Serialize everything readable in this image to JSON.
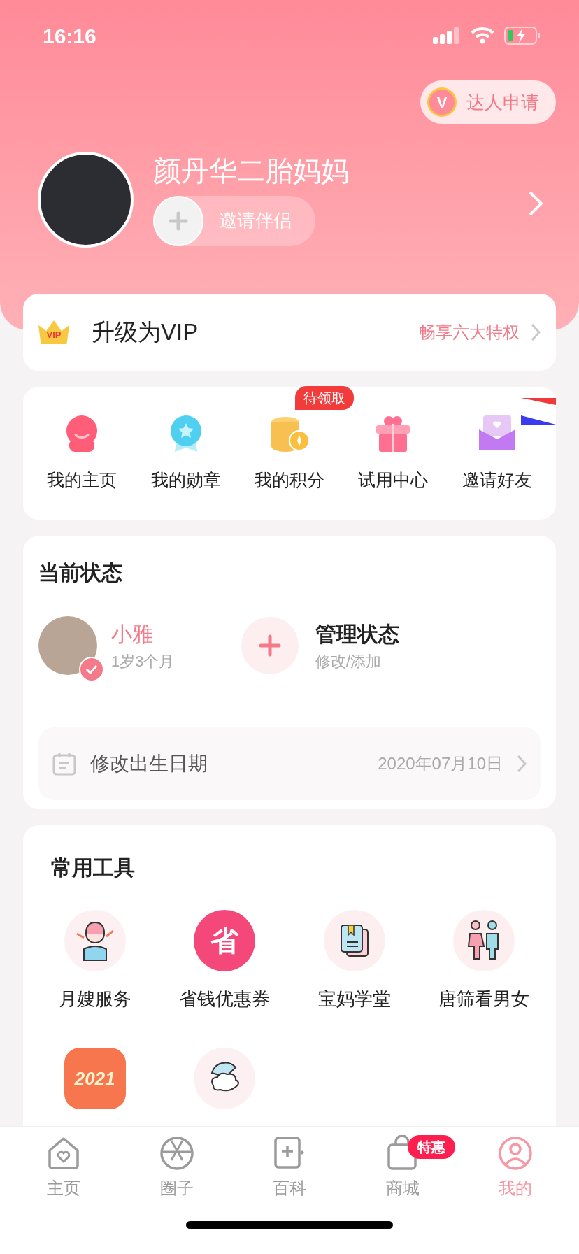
{
  "status_bar": {
    "time": "16:16"
  },
  "header": {
    "expert_badge": "V",
    "expert_button": "达人申请",
    "username": "颜丹华二胎妈妈",
    "invite_partner": "邀请伴侣"
  },
  "vip_banner": {
    "badge": "VIP",
    "title": "升级为VIP",
    "link": "畅享六大特权"
  },
  "shortcuts": [
    {
      "kind": "home",
      "label": "我的主页"
    },
    {
      "kind": "medal",
      "label": "我的勋章"
    },
    {
      "kind": "points",
      "label": "我的积分",
      "badge": "待领取"
    },
    {
      "kind": "gift",
      "label": "试用中心"
    },
    {
      "kind": "invite",
      "label": "邀请好友"
    }
  ],
  "current_status": {
    "title": "当前状态",
    "baby": {
      "name": "小雅",
      "age": "1岁3个月",
      "selected": true
    },
    "manage": {
      "title": "管理状态",
      "subtitle": "修改/添加"
    },
    "birth_date": {
      "label": "修改出生日期",
      "value": "2020年07月10日"
    }
  },
  "tools": {
    "title": "常用工具",
    "items": [
      {
        "kind": "nanny",
        "label": "月嫂服务"
      },
      {
        "kind": "coupon",
        "label": "省钱优惠券",
        "glyph": "省"
      },
      {
        "kind": "school",
        "label": "宝妈学堂"
      },
      {
        "kind": "gender",
        "label": "唐筛看男女"
      },
      {
        "kind": "fortune",
        "glyph": "2021"
      },
      {
        "kind": "fetus"
      }
    ]
  },
  "tab_bar": [
    {
      "kind": "home",
      "label": "主页",
      "selected": false
    },
    {
      "kind": "circle",
      "label": "圈子",
      "selected": false
    },
    {
      "kind": "wiki",
      "label": "百科",
      "selected": false
    },
    {
      "kind": "shop",
      "label": "商城",
      "selected": false,
      "badge": "特惠"
    },
    {
      "kind": "me",
      "label": "我的",
      "selected": true
    }
  ]
}
